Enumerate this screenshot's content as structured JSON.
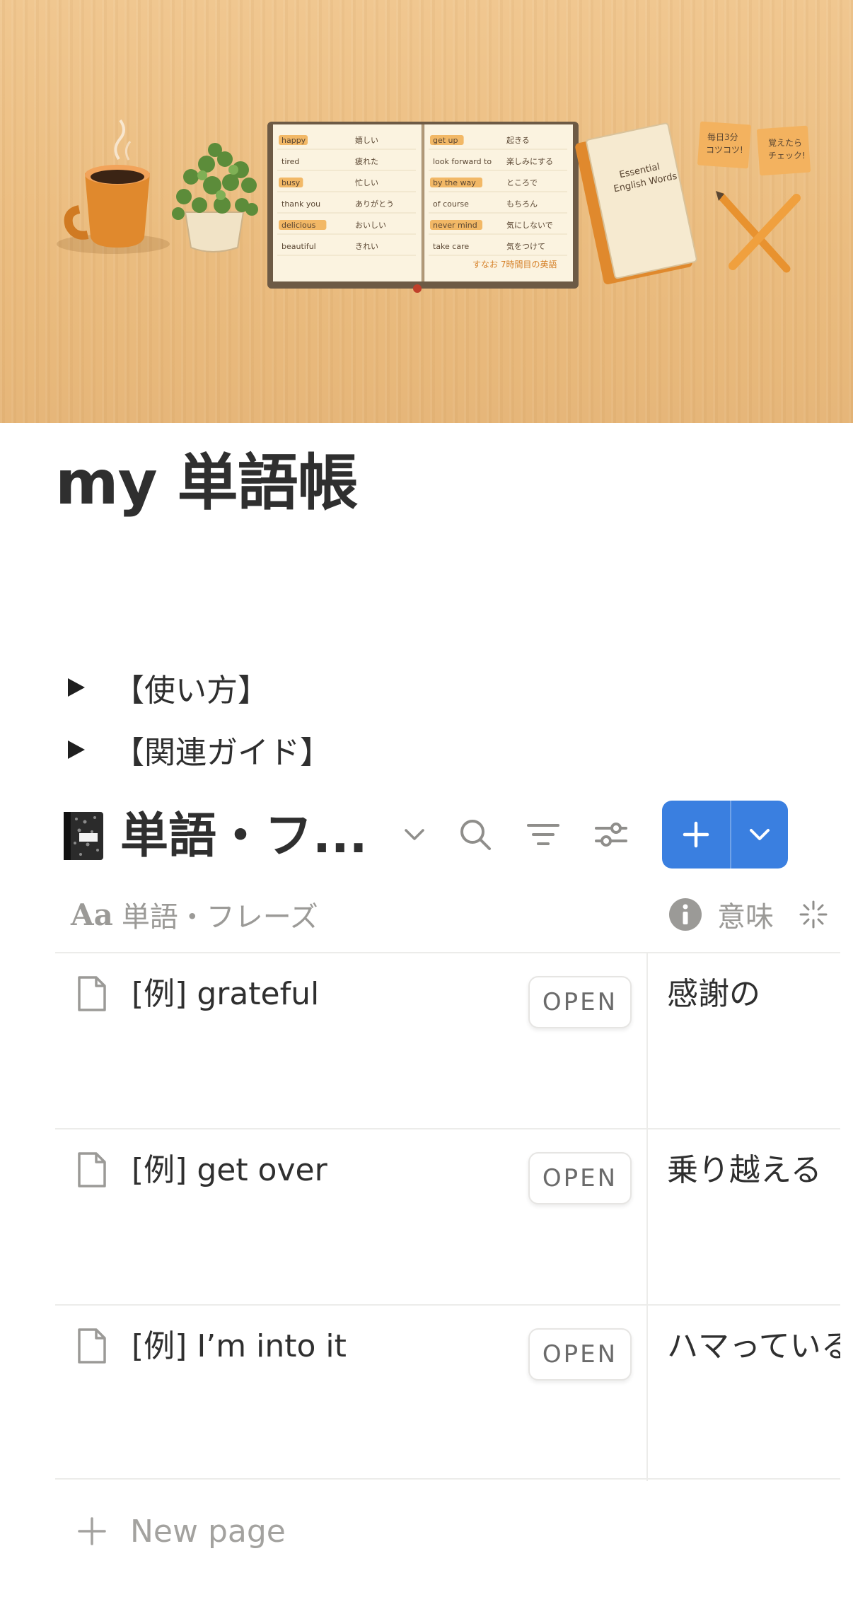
{
  "cover": {
    "notebook_left_words": [
      {
        "en": "happy",
        "ja": "嬉しい"
      },
      {
        "en": "tired",
        "ja": "疲れた"
      },
      {
        "en": "busy",
        "ja": "忙しい"
      },
      {
        "en": "thank you",
        "ja": "ありがとう"
      },
      {
        "en": "delicious",
        "ja": "おいしい"
      },
      {
        "en": "beautiful",
        "ja": "きれい"
      }
    ],
    "notebook_right_words": [
      {
        "en": "get up",
        "ja": "起きる"
      },
      {
        "en": "look forward to",
        "ja": "楽しみにする"
      },
      {
        "en": "by the way",
        "ja": "ところで"
      },
      {
        "en": "of course",
        "ja": "もちろん"
      },
      {
        "en": "never mind",
        "ja": "気にしないで"
      },
      {
        "en": "take care",
        "ja": "気をつけて"
      }
    ],
    "notebook_footer": "すなお 7時間目の英語",
    "book_title_line1": "Essential",
    "book_title_line2": "English Words",
    "sticky_note_1": [
      "毎日3分",
      "コツコツ!"
    ],
    "sticky_note_2": [
      "覚えたら",
      "チェック!"
    ]
  },
  "page": {
    "title": "my 単語帳"
  },
  "toggles": [
    {
      "label": "【使い方】"
    },
    {
      "label": "【関連ガイド】"
    }
  ],
  "database": {
    "icon": "notebook-icon",
    "title": "単語・フ...",
    "new_button_label": "+",
    "columns": [
      {
        "icon": "aa-text-icon",
        "icon_text": "Aa",
        "label": "単語・フレーズ"
      },
      {
        "icon": "info-icon",
        "label": "意味"
      }
    ],
    "rows": [
      {
        "name": "[例] grateful",
        "open_label": "OPEN",
        "meaning": "感謝の"
      },
      {
        "name": "[例] get over",
        "open_label": "OPEN",
        "meaning": "乗り越える"
      },
      {
        "name": "[例] I’m into it",
        "open_label": "OPEN",
        "meaning": "ハマっている"
      }
    ],
    "new_page_label": "New page"
  },
  "colors": {
    "accent": "#3a7fe0",
    "text": "#2f2f2f",
    "muted": "#9b9a97",
    "cover_wood": "#ecc083",
    "highlight": "#f0a83c"
  }
}
